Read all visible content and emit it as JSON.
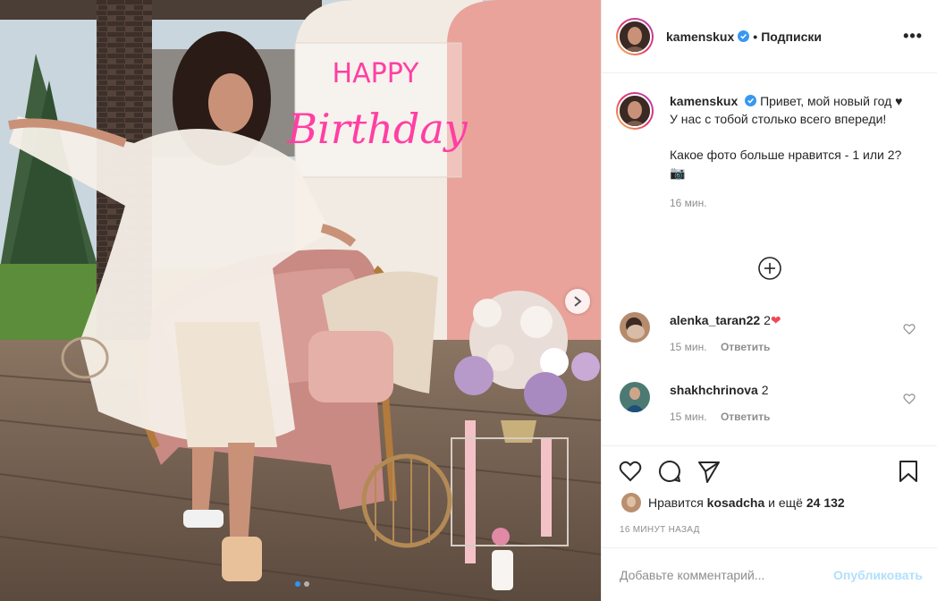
{
  "photo": {
    "neon_line1": "HAPPY",
    "neon_line2": "Birthday",
    "carousel_count": 2,
    "carousel_index": 1
  },
  "header": {
    "username": "kamenskux",
    "separator": "•",
    "follow_label": "Подписки",
    "more_label": "•••"
  },
  "caption": {
    "username": "kamenskux",
    "text_line1": "Привет, мой новый год ♥ У нас с тобой столько всего впереди!",
    "text_line2": "Какое фото больше нравится - 1 или 2?📷",
    "time": "16 мин."
  },
  "comments": [
    {
      "username": "alenka_taran22",
      "text": "2",
      "emoji": "❤",
      "time": "15 мин.",
      "reply": "Ответить"
    },
    {
      "username": "shakhchrinova",
      "text": "2",
      "time": "15 мин.",
      "reply": "Ответить"
    }
  ],
  "likes": {
    "prefix": "Нравится",
    "liker": "kosadcha",
    "middle": "и ещё",
    "count": "24 132"
  },
  "posted": "16 МИНУТ НАЗАД",
  "add_comment": {
    "placeholder": "Добавьте комментарий...",
    "publish_label": "Опубликовать"
  },
  "colors": {
    "accent_blue": "#0095f6",
    "publish_disabled": "#b2dffc",
    "like_red": "#ed4956",
    "neon_pink": "#ff3fa3"
  }
}
